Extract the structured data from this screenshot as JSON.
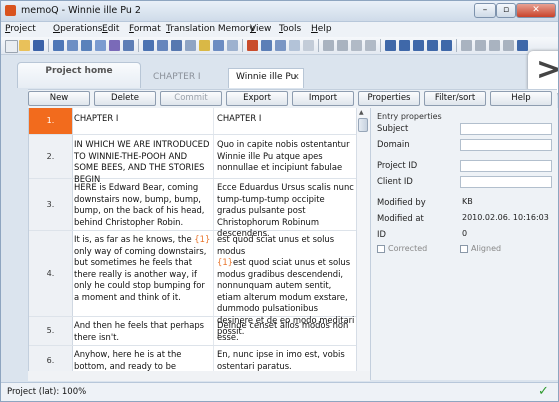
{
  "window": {
    "title": "memoQ - Winnie ille Pu 2"
  },
  "menu": [
    "Project",
    "Operations",
    "Edit",
    "Format",
    "Translation Memory",
    "View",
    "Tools",
    "Help"
  ],
  "tabs": {
    "home": "Project home",
    "chapter": "CHAPTER I",
    "doc": "Winnie ille Pu",
    "doc_close": "x"
  },
  "buttons": [
    "New",
    "Delete",
    "Commit",
    "Export",
    "Import",
    "Properties",
    "Filter/sort",
    "Help"
  ],
  "rows": [
    {
      "num": "1.",
      "src": "CHAPTER I",
      "tgt": "CHAPTER I"
    },
    {
      "num": "2.",
      "src": "IN WHICH WE ARE INTRODUCED TO WINNIE-THE-POOH AND SOME BEES, AND THE STORIES BEGIN",
      "tgt": "Quo in capite nobis ostentantur Winnie ille Pu atque apes nonnullae et incipiunt fabulae"
    },
    {
      "num": "3.",
      "src": "HERE is Edward Bear, coming downstairs now, bump, bump, bump, on the back of his head, behind Christopher Robin.",
      "tgt": "Ecce Eduardus Ursus scalis nunc tump-tump-tump occipite gradus pulsante post Christophorum Robinum descendens."
    },
    {
      "num": "4.",
      "src_a": "It is, as far as he knows, the ",
      "src_tag": "{1}",
      "src_b": " only way of coming downstairs, but sometimes he feels that there really is another way, if only he could stop bumping for a moment and think of it.",
      "tgt_a": "est quod sciat unus et solus modus ",
      "tgt_tag": "{1}",
      "tgt_b": "est quod sciat unus et solus modus gradibus descendendi, nonnunquam autem sentit, etiam alterum modum exstare, dummodo pulsationibus desinere et de eo modo meditari possit."
    },
    {
      "num": "5.",
      "src": "And then he feels that perhaps there isn't.",
      "tgt": "Deinde censet alios modos non esse."
    },
    {
      "num": "6.",
      "src": "Anyhow, here he is at the bottom, and ready to be introduced to you.",
      "tgt": "En, nunc ipse in imo est, vobis ostentari paratus."
    }
  ],
  "props": {
    "title": "Entry properties",
    "subject": "Subject",
    "domain": "Domain",
    "project_id": "Project ID",
    "client_id": "Client ID",
    "modified_by_label": "Modified by",
    "modified_by": "KB",
    "modified_at_label": "Modified at",
    "modified_at": "2010.02.06. 10:16:03",
    "id_label": "ID",
    "id": "0",
    "corrected": "Corrected",
    "aligned": "Aligned"
  },
  "status": {
    "text": "Project (lat): 100%"
  },
  "colors": {
    "active_row": "#f26b1d",
    "tag": "#e8752c",
    "ok": "#2e9a2e"
  }
}
